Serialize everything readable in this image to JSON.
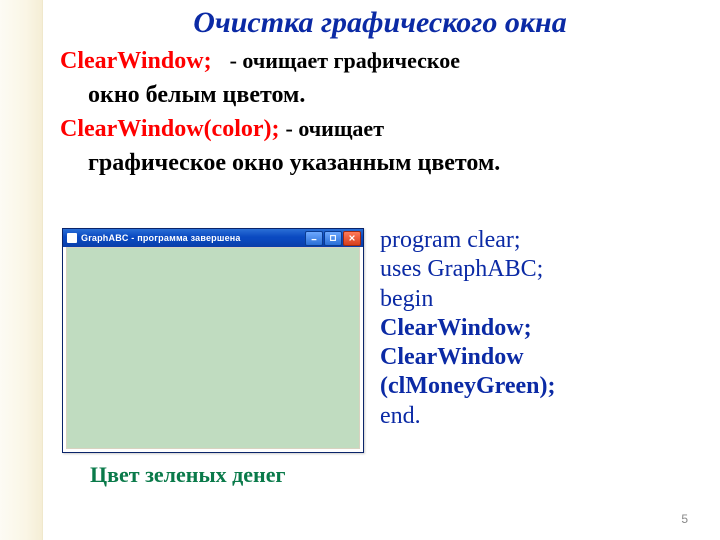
{
  "title": "Очистка графического окна",
  "def1": {
    "keyword": "ClearWindow;",
    "desc_line1": "-  очищает  графическое",
    "desc_line2": "окно белым цветом."
  },
  "def2": {
    "keyword": "ClearWindow(color);",
    "desc_line1": "- очищает",
    "desc_line2": "графическое окно указанным цветом."
  },
  "window": {
    "title": "GraphABC - программа завершена",
    "btn_min": "minimize",
    "btn_max": "maximize",
    "btn_close": "close"
  },
  "caption": "Цвет зеленых денег",
  "code": {
    "l1": "program clear;",
    "l2": "uses GraphABC;",
    "l3": "begin",
    "l4": "ClearWindow;",
    "l5": "ClearWindow",
    "l6": "(clMoneyGreen);",
    "l7": "end."
  },
  "page": "5"
}
